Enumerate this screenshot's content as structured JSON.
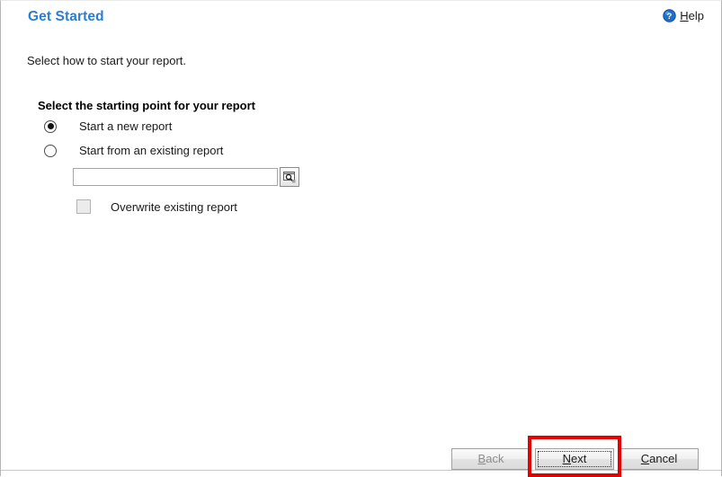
{
  "window": {
    "title": "Get Started"
  },
  "header": {
    "title": "Get Started",
    "help": {
      "label_prefix": "H",
      "label_rest": "elp",
      "full_label": "Help",
      "icon": "help-circle-icon",
      "icon_color": "#1f6fd0"
    }
  },
  "main": {
    "intro_text": "Select how to start your report.",
    "section_heading": "Select the starting point for your report",
    "options": [
      {
        "label": "Start a new report",
        "selected": true
      },
      {
        "label": "Start from an existing report",
        "selected": false
      }
    ],
    "existing_report": {
      "value": "",
      "placeholder": "",
      "browse_icon": "browse-search-icon",
      "browse_tooltip": "Browse"
    },
    "overwrite": {
      "label": "Overwrite existing report",
      "checked": false,
      "enabled": false
    }
  },
  "footer": {
    "buttons": [
      {
        "name": "back",
        "underlined": "B",
        "rest": "ack",
        "full_label": "Back",
        "enabled": false,
        "focused": false
      },
      {
        "name": "next",
        "underlined": "N",
        "rest": "ext",
        "full_label": "Next",
        "enabled": true,
        "focused": true
      },
      {
        "name": "cancel",
        "underlined": "C",
        "rest": "ancel",
        "full_label": "Cancel",
        "enabled": true,
        "focused": false
      }
    ]
  },
  "annotation": {
    "highlight_target": "next-button",
    "highlight_color": "#e60000"
  },
  "colors": {
    "title_blue": "#2b7cd3",
    "text": "#1a1a1a",
    "disabled_text": "#8d8d8d",
    "button_face": "#f0f0f0",
    "border": "#a0a0a0"
  }
}
